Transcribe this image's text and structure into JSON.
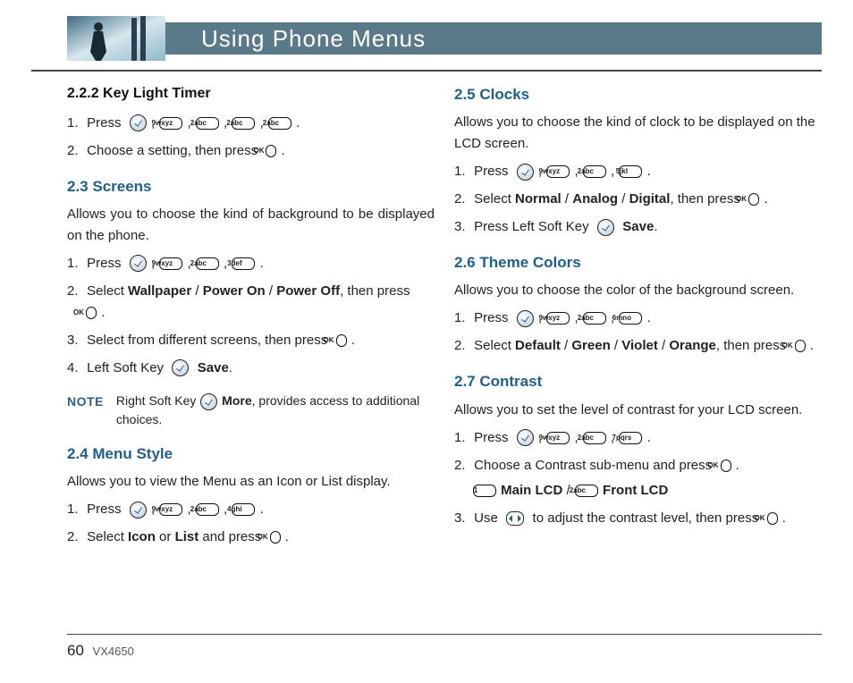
{
  "header": {
    "title": "Using Phone Menus"
  },
  "footer": {
    "page": "60",
    "model": "VX4650"
  },
  "keys": {
    "ok": "OK",
    "1": "1",
    "1s": "",
    "2": "2",
    "2s": "abc",
    "3": "3",
    "3s": "def",
    "4": "4",
    "4s": "ghi",
    "5": "5",
    "5s": "jkl",
    "6": "6",
    "6s": "mno",
    "7": "7",
    "7s": "pqrs",
    "9": "9",
    "9s": "wxyz"
  },
  "left": {
    "s222_h": "2.2.2 Key Light Timer",
    "s222_1a": "Press",
    "s222_2a": "Choose a setting, then press",
    "s23_h": "2.3 Screens",
    "s23_intro": "Allows you to choose the kind of background to be displayed on the phone.",
    "s23_1a": "Press",
    "s23_2a": "Select ",
    "s23_2b": "Wallpaper",
    "s23_2c": " / ",
    "s23_2d": "Power On",
    "s23_2e": " / ",
    "s23_2f": "Power Off",
    "s23_2g": ", then press",
    "s23_3a": "Select from different screens, then press",
    "s23_4a": "Left Soft Key",
    "s23_4b": "Save",
    "note_label": "NOTE",
    "note_a": "Right Soft Key ",
    "note_b": "More",
    "note_c": ", provides access to additional choices.",
    "s24_h": "2.4 Menu Style",
    "s24_intro": "Allows you to view the Menu as an Icon or List display.",
    "s24_1a": "Press",
    "s24_2a": "Select ",
    "s24_2b": "Icon",
    "s24_2c": " or ",
    "s24_2d": "List",
    "s24_2e": " and press"
  },
  "right": {
    "s25_h": "2.5 Clocks",
    "s25_intro": "Allows you to choose the kind of clock to be displayed on the LCD screen.",
    "s25_1a": "Press",
    "s25_2a": "Select ",
    "s25_2b": "Normal",
    "s25_2c": " / ",
    "s25_2d": "Analog",
    "s25_2e": " / ",
    "s25_2f": "Digital",
    "s25_2g": ", then press",
    "s25_3a": "Press Left Soft Key",
    "s25_3b": "Save",
    "s26_h": "2.6 Theme Colors",
    "s26_intro": "Allows you to choose the color of the background screen.",
    "s26_1a": "Press",
    "s26_2a": "Select ",
    "s26_2b": "Default",
    "s26_2c": " / ",
    "s26_2d": "Green",
    "s26_2e": " / ",
    "s26_2f": "Violet",
    "s26_2g": " / ",
    "s26_2h": "Orange",
    "s26_2i": ", then press",
    "s27_h": "2.7 Contrast",
    "s27_intro": "Allows you to set the level of contrast for your LCD screen.",
    "s27_1a": "Press",
    "s27_2a": "Choose a Contrast sub-menu and press",
    "s27_2b": "Main LCD",
    "s27_2c": " / ",
    "s27_2d": "Front LCD",
    "s27_3a": "Use",
    "s27_3b": "to adjust the contrast level, then press"
  }
}
